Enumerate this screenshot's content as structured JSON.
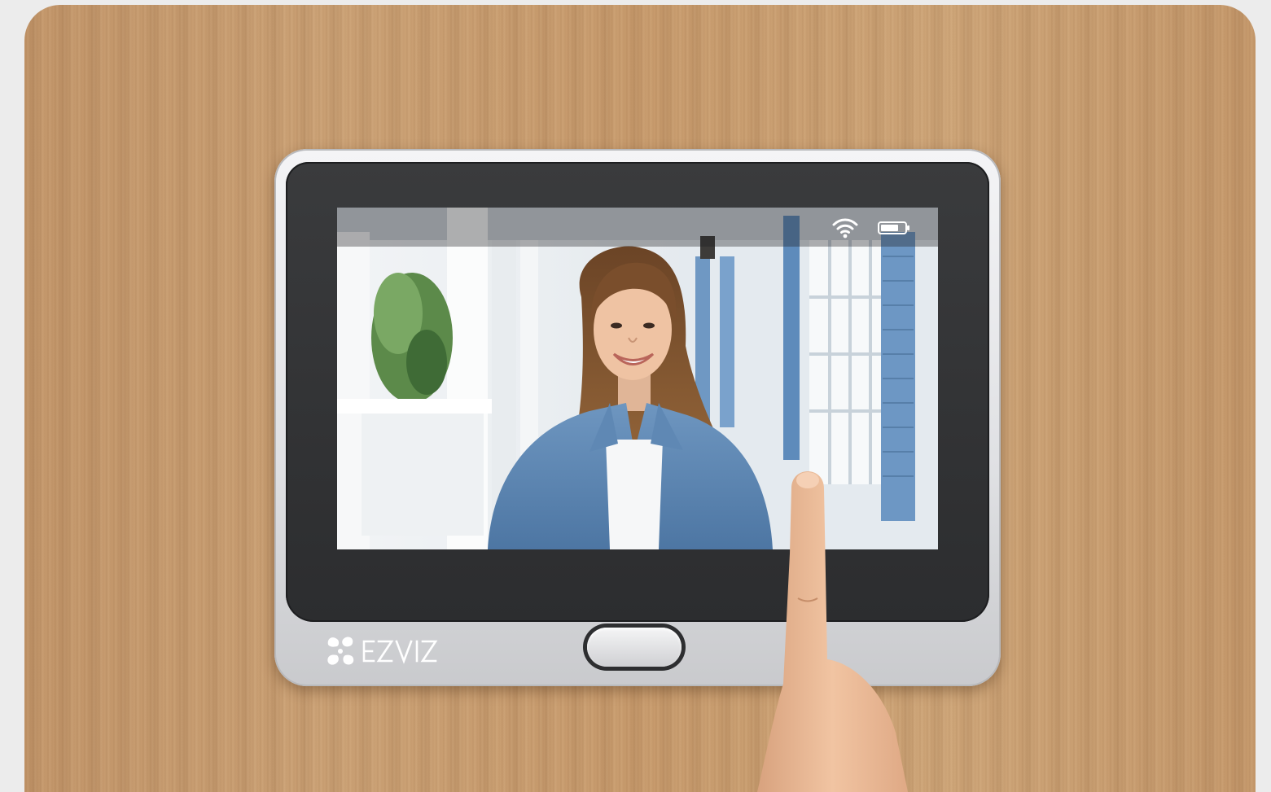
{
  "brand": {
    "name": "EZVIZ",
    "logo_color": "#ffffff"
  },
  "colors": {
    "wood": "#c79a6c",
    "device_frame": "#e2e3e6",
    "bezel": "#2f3032",
    "page_background": "#ececec"
  },
  "screen_status": {
    "wifi_icon": "wifi-icon",
    "battery_icon": "battery-icon"
  }
}
